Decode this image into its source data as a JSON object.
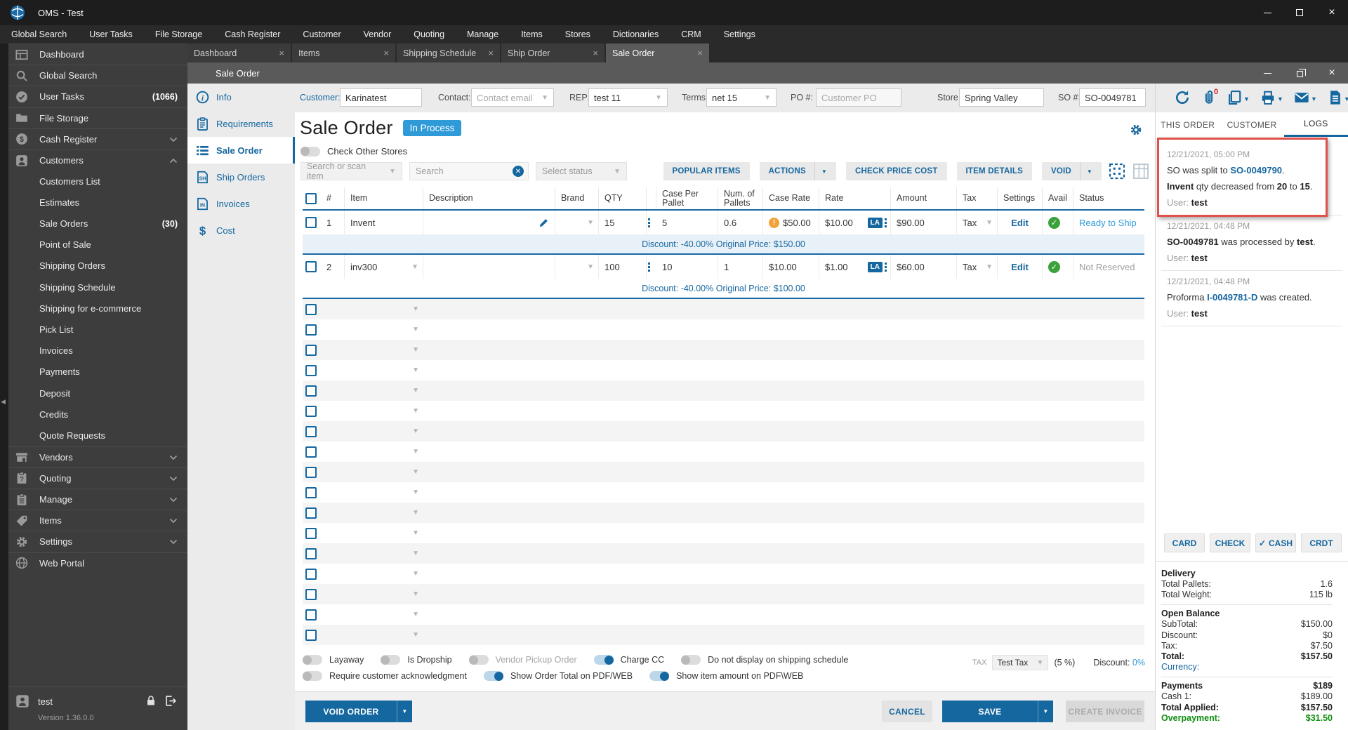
{
  "titlebar": {
    "title": "OMS - Test"
  },
  "menu": {
    "items": [
      "Global Search",
      "User Tasks",
      "File Storage",
      "Cash Register",
      "Customer",
      "Vendor",
      "Quoting",
      "Manage",
      "Items",
      "Stores",
      "Dictionaries",
      "CRM",
      "Settings"
    ]
  },
  "tabs": [
    {
      "label": "Dashboard"
    },
    {
      "label": "Items"
    },
    {
      "label": "Shipping Schedule"
    },
    {
      "label": "Ship Order"
    },
    {
      "label": "Sale Order",
      "active": true
    }
  ],
  "sidebar": {
    "items": [
      {
        "label": "Dashboard",
        "icon": "dashboard"
      },
      {
        "label": "Global Search",
        "icon": "search"
      },
      {
        "label": "User Tasks",
        "icon": "check-circle",
        "badge": "(1066)"
      },
      {
        "label": "File Storage",
        "icon": "folder"
      },
      {
        "label": "Cash Register",
        "icon": "dollar",
        "chevron": "down"
      },
      {
        "label": "Customers",
        "icon": "person",
        "chevron": "up"
      },
      {
        "label": "Customers List",
        "sub": true
      },
      {
        "label": "Estimates",
        "sub": true
      },
      {
        "label": "Sale Orders",
        "sub": true,
        "badge": "(30)"
      },
      {
        "label": "Point of Sale",
        "sub": true
      },
      {
        "label": "Shipping Orders",
        "sub": true
      },
      {
        "label": "Shipping Schedule",
        "sub": true
      },
      {
        "label": "Shipping for e-commerce",
        "sub": true
      },
      {
        "label": "Pick List",
        "sub": true
      },
      {
        "label": "Invoices",
        "sub": true
      },
      {
        "label": "Payments",
        "sub": true
      },
      {
        "label": "Deposit",
        "sub": true
      },
      {
        "label": "Credits",
        "sub": true
      },
      {
        "label": "Quote Requests",
        "sub": true
      },
      {
        "label": "Vendors",
        "icon": "store",
        "chevron": "down"
      },
      {
        "label": "Quoting",
        "icon": "quote",
        "chevron": "down"
      },
      {
        "label": "Manage",
        "icon": "clipboard",
        "chevron": "down"
      },
      {
        "label": "Items",
        "icon": "tag",
        "chevron": "down"
      },
      {
        "label": "Settings",
        "icon": "gear",
        "chevron": "down"
      },
      {
        "label": "Web Portal",
        "icon": "globe"
      }
    ],
    "user": "test",
    "version": "Version 1.36.0.0"
  },
  "window": {
    "title": "Sale Order"
  },
  "form": {
    "customer": {
      "label": "Customer:",
      "value": "Karinatest"
    },
    "contact": {
      "label": "Contact:",
      "placeholder": "Contact email"
    },
    "rep": {
      "label": "REP:",
      "value": "test 11"
    },
    "terms": {
      "label": "Terms:",
      "value": "net 15"
    },
    "po": {
      "label": "PO #:",
      "placeholder": "Customer PO"
    },
    "store": {
      "label": "Store:",
      "value": "Spring Valley"
    },
    "so": {
      "label": "SO #:",
      "value": "SO-0049781"
    },
    "attachment_badge": "0"
  },
  "nav": {
    "items": [
      {
        "label": "Info",
        "icon": "info"
      },
      {
        "label": "Requirements",
        "icon": "clipboard-lines"
      },
      {
        "label": "Sale Order",
        "icon": "list",
        "active": true
      },
      {
        "label": "Ship Orders",
        "icon": "doc-sh"
      },
      {
        "label": "Invoices",
        "icon": "doc-in"
      },
      {
        "label": "Cost",
        "icon": "cost"
      }
    ]
  },
  "content": {
    "title": "Sale Order",
    "badge": "In Process",
    "check_other_stores": "Check Other Stores",
    "search_select": "Search or scan item",
    "search_placeholder": "Search",
    "status_select": "Select status",
    "toolbar_buttons": [
      {
        "label": "POPULAR ITEMS"
      },
      {
        "label": "ACTIONS",
        "dropdown": true
      },
      {
        "label": "CHECK PRICE COST"
      },
      {
        "label": "ITEM DETAILS"
      },
      {
        "label": "VOID",
        "dropdown": true
      }
    ]
  },
  "table": {
    "columns": [
      "#",
      "Item",
      "Description",
      "Brand",
      "QTY",
      "Case Per Pallet",
      "Num. of Pallets",
      "Case Rate",
      "Rate",
      "Amount",
      "Tax",
      "Settings",
      "Avail",
      "Status"
    ],
    "rows": [
      {
        "num": "1",
        "item": "Invent",
        "item_dropdown": false,
        "qty": "15",
        "case_per_pallet": "5",
        "num_pallets": "0.6",
        "case_rate": "$50.00",
        "case_rate_warning": true,
        "rate": "$10.00",
        "rate_badge": "LA",
        "amount": "$90.00",
        "tax": "Tax",
        "settings": "Edit",
        "status": "Ready to Ship",
        "status_style": "link",
        "discount": "Discount: -40.00% Original Price: $150.00"
      },
      {
        "num": "2",
        "item": "inv300",
        "item_dropdown": true,
        "qty": "100",
        "case_per_pallet": "10",
        "num_pallets": "1",
        "case_rate": "$10.00",
        "case_rate_warning": false,
        "rate": "$1.00",
        "rate_badge": "LA",
        "amount": "$60.00",
        "tax": "Tax",
        "settings": "Edit",
        "status": "Not Reserved",
        "status_style": "muted",
        "discount": "Discount: -40.00% Original Price: $100.00"
      }
    ],
    "empty_rows": 17
  },
  "options": {
    "row1": [
      {
        "label": "Layaway",
        "on": false
      },
      {
        "label": "Is Dropship",
        "on": false
      },
      {
        "label": "Vendor Pickup Order",
        "on": false,
        "disabled": true
      },
      {
        "label": "Charge CC",
        "on": true
      },
      {
        "label": "Do not display on shipping schedule",
        "on": false
      }
    ],
    "row2": [
      {
        "label": "Require customer acknowledgment",
        "on": false
      },
      {
        "label": "Show Order Total on PDF/WEB",
        "on": true
      },
      {
        "label": "Show item amount on PDF\\WEB",
        "on": true
      }
    ],
    "tax_label": "TAX",
    "tax_value": "Test Tax",
    "tax_rate": "(5 %)",
    "discount_label": "Discount:",
    "discount_value": "0%"
  },
  "footer_buttons": {
    "void": "VOID ORDER",
    "cancel": "CANCEL",
    "save": "SAVE",
    "create_invoice": "CREATE INVOICE"
  },
  "right_panel": {
    "tabs": [
      {
        "label": "THIS ORDER"
      },
      {
        "label": "CUSTOMER"
      },
      {
        "label": "LOGS",
        "active": true
      }
    ],
    "logs": [
      {
        "time": "12/21/2021, 05:00 PM",
        "highlight": true,
        "lines": [
          [
            {
              "t": "SO was split to "
            },
            {
              "t": "SO-0049790",
              "c": "link"
            },
            {
              "t": "."
            }
          ],
          [
            {
              "t": "Invent",
              "c": "bold"
            },
            {
              "t": " qty decreased from "
            },
            {
              "t": "20",
              "c": "bold"
            },
            {
              "t": " to "
            },
            {
              "t": "15",
              "c": "bold"
            },
            {
              "t": "."
            }
          ],
          [
            {
              "t": "User: ",
              "c": "muted"
            },
            {
              "t": "test",
              "c": "bold"
            }
          ]
        ]
      },
      {
        "time": "12/21/2021, 04:48 PM",
        "lines": [
          [
            {
              "t": "SO-0049781",
              "c": "bold"
            },
            {
              "t": " was processed by "
            },
            {
              "t": "test",
              "c": "bold"
            },
            {
              "t": "."
            }
          ],
          [
            {
              "t": "User: ",
              "c": "muted"
            },
            {
              "t": "test",
              "c": "bold"
            }
          ]
        ]
      },
      {
        "time": "12/21/2021, 04:48 PM",
        "lines": [
          [
            {
              "t": "Proforma "
            },
            {
              "t": "I-0049781-D",
              "c": "link"
            },
            {
              "t": " was created."
            }
          ],
          [
            {
              "t": "User: ",
              "c": "muted"
            },
            {
              "t": "test",
              "c": "bold"
            }
          ]
        ]
      }
    ],
    "payment_buttons": [
      {
        "label": "CARD"
      },
      {
        "label": "CHECK"
      },
      {
        "label": "CASH",
        "check": true
      },
      {
        "label": "CRDT"
      }
    ],
    "sections": [
      {
        "title": "Delivery",
        "rows": [
          {
            "label": "Total Pallets:",
            "value": "1.6"
          },
          {
            "label": "Total Weight:",
            "value": "115 lb"
          }
        ]
      },
      {
        "title": "Open Balance",
        "rows": [
          {
            "label": "SubTotal:",
            "value": "$150.00"
          },
          {
            "label": "Discount:",
            "value": "$0"
          },
          {
            "label": "Tax:",
            "value": "$7.50"
          },
          {
            "label": "Total:",
            "value": "$157.50",
            "bold": true
          },
          {
            "label": "Currency:",
            "value": "",
            "link": true
          }
        ]
      },
      {
        "title": "Payments",
        "title_value": "$189",
        "rows": [
          {
            "label": "Cash 1:",
            "value": "$189.00"
          },
          {
            "label": "Total Applied:",
            "value": "$157.50",
            "bold": true
          },
          {
            "label": "Overpayment:",
            "value": "$31.50",
            "green": true
          }
        ]
      }
    ]
  }
}
